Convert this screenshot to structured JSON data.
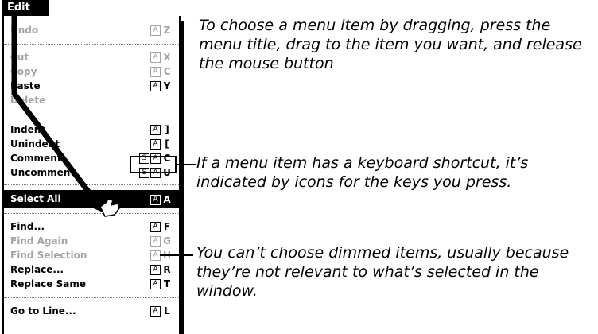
{
  "menu": {
    "title": "Edit",
    "items": [
      {
        "label": "Undo",
        "shift": false,
        "key": "Z",
        "dim": true
      },
      {
        "label": "Cut",
        "shift": false,
        "key": "X",
        "dim": true
      },
      {
        "label": "Copy",
        "shift": false,
        "key": "C",
        "dim": true
      },
      {
        "label": "Paste",
        "shift": false,
        "key": "Y",
        "dim": false
      },
      {
        "label": "Delete",
        "shift": false,
        "key": "",
        "dim": true
      },
      {
        "label": "Indent",
        "shift": false,
        "key": "]",
        "dim": false
      },
      {
        "label": "Unindent",
        "shift": false,
        "key": "[",
        "dim": false
      },
      {
        "label": "Comment",
        "shift": true,
        "key": "C",
        "dim": false
      },
      {
        "label": "Uncomment",
        "shift": true,
        "key": "U",
        "dim": false
      },
      {
        "label": "Select All",
        "shift": false,
        "key": "A",
        "dim": false,
        "selected": true
      },
      {
        "label": "Find...",
        "shift": false,
        "key": "F",
        "dim": false
      },
      {
        "label": "Find Again",
        "shift": false,
        "key": "G",
        "dim": true
      },
      {
        "label": "Find Selection",
        "shift": false,
        "key": "H",
        "dim": true
      },
      {
        "label": "Replace...",
        "shift": false,
        "key": "R",
        "dim": false
      },
      {
        "label": "Replace Same",
        "shift": false,
        "key": "T",
        "dim": false
      },
      {
        "label": "Go to Line...",
        "shift": false,
        "key": "L",
        "dim": false
      }
    ],
    "cmd_glyph": "A",
    "shift_glyph": "S"
  },
  "callouts": {
    "drag": "To choose a menu item by dragging, press the menu title, drag to the item you want, and release the mouse button",
    "shortcut": "If a menu item has a keyboard shortcut, it’s indicated by icons for the keys you press.",
    "dimmed": "You can’t choose dimmed items, usually because they’re not relevant to what’s selected in the window."
  },
  "colors": {
    "dimmed": "#a3a3a3",
    "highlight": "#000000"
  }
}
